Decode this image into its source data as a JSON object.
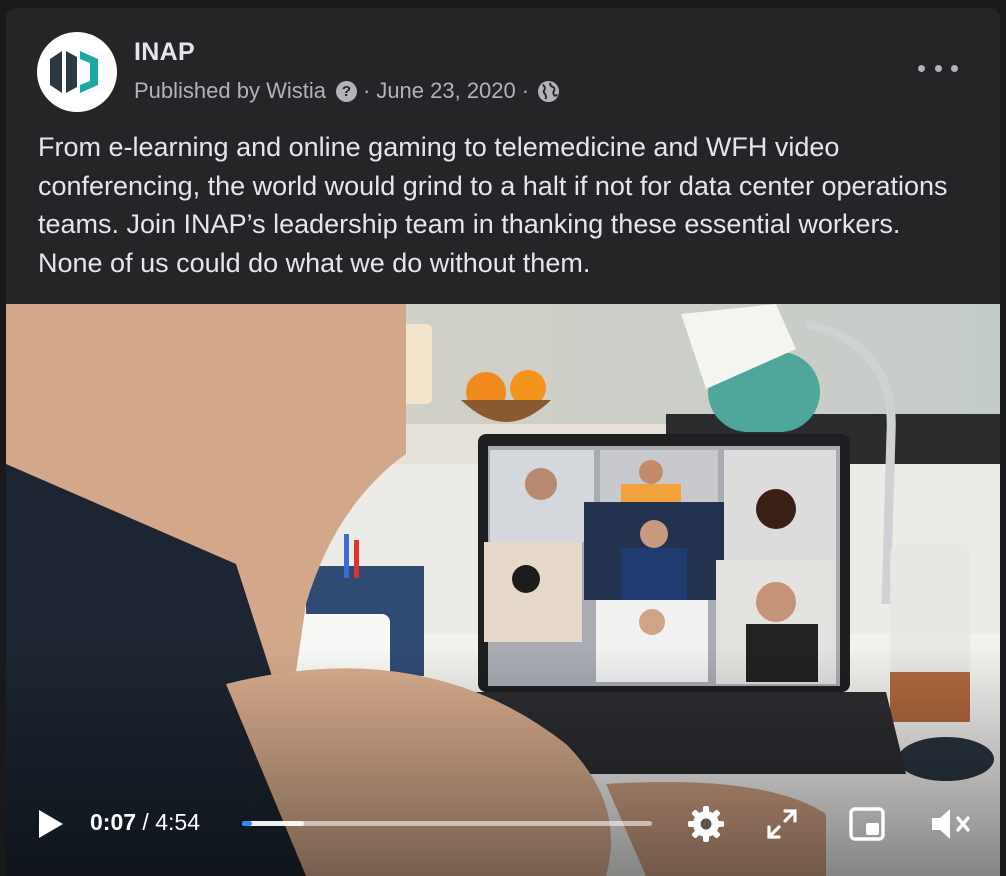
{
  "post": {
    "page_name": "INAP",
    "published_by": "Published by Wistia",
    "date": "June 23, 2020",
    "separator": "·",
    "help_glyph": "?",
    "caption": "From e-learning and online gaming to telemedicine and WFH video conferencing, the world would grind to a halt if not for data center operations teams. Join INAP’s leadership team in thanking these essential workers. None of us could do what we do without them.",
    "audience_icon": "globe-icon",
    "more_icon": "more-options-icon"
  },
  "video": {
    "current_time": "0:07",
    "time_separator": " / ",
    "duration": "4:54",
    "progress_fraction": 0.024,
    "buffered_fraction": 0.15,
    "state": "paused",
    "muted": true,
    "icons": [
      "play-icon",
      "settings-icon",
      "fullscreen-icon",
      "picture-in-picture-icon",
      "mute-icon"
    ]
  },
  "colors": {
    "background": "#18191a",
    "card": "#242526",
    "primary_text": "#e4e6eb",
    "secondary_text": "#b0b3b8",
    "progress": "#2d88ff",
    "logo_teal": "#17a9a6",
    "logo_dark": "#2b3a42"
  }
}
